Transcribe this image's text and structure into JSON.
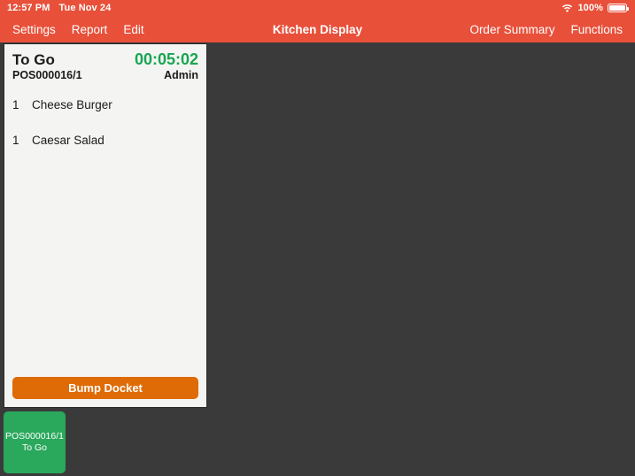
{
  "status_bar": {
    "time": "12:57 PM",
    "date": "Tue Nov 24",
    "wifi_icon": "wifi-icon",
    "battery_percent": "100%",
    "battery_icon": "battery-full-icon",
    "battery_level": 100
  },
  "nav_bar": {
    "title": "Kitchen Display",
    "left_items": [
      {
        "label": "Settings"
      },
      {
        "label": "Report"
      },
      {
        "label": "Edit"
      }
    ],
    "right_items": [
      {
        "label": "Order Summary"
      },
      {
        "label": "Functions"
      }
    ]
  },
  "docket": {
    "order_type": "To Go",
    "order_id": "POS000016/1",
    "timer": "00:05:02",
    "user": "Admin",
    "items": [
      {
        "qty": "1",
        "name": "Cheese Burger"
      },
      {
        "qty": "1",
        "name": "Caesar Salad"
      }
    ],
    "bump_label": "Bump Docket"
  },
  "summary_tiles": [
    {
      "order_id": "POS000016/1",
      "order_type": "To Go"
    }
  ],
  "colors": {
    "nav_background": "#e8503a",
    "app_background": "#3a3a3a",
    "card_background": "#f4f4f2",
    "timer_green": "#18a552",
    "bump_orange": "#df6b06",
    "tile_green": "#2aa85c"
  }
}
